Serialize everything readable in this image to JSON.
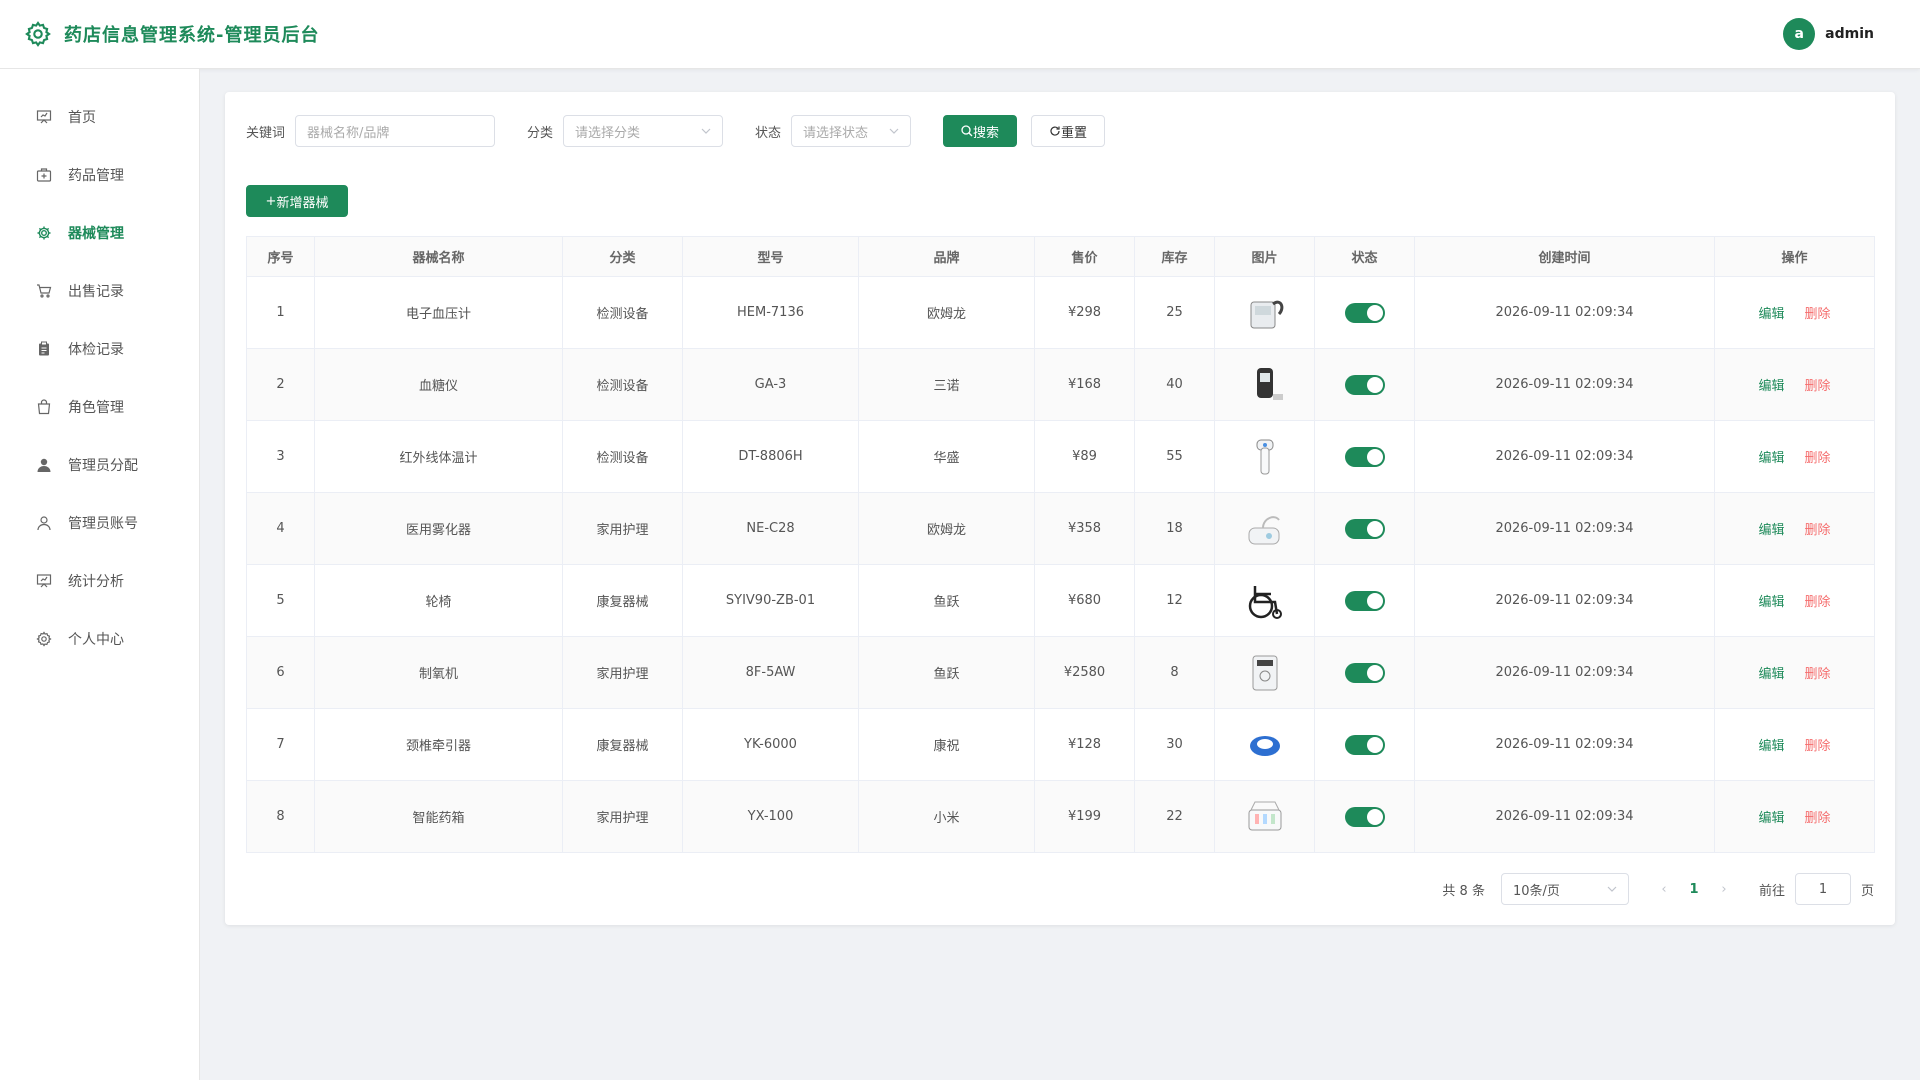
{
  "header": {
    "title": "药店信息管理系统-管理员后台",
    "avatar_letter": "a",
    "username": "admin"
  },
  "sidebar": {
    "items": [
      {
        "label": "首页",
        "icon": "presentation-icon"
      },
      {
        "label": "药品管理",
        "icon": "medicine-box-icon"
      },
      {
        "label": "器械管理",
        "icon": "gear-icon",
        "active": true
      },
      {
        "label": "出售记录",
        "icon": "cart-icon"
      },
      {
        "label": "体检记录",
        "icon": "clipboard-icon"
      },
      {
        "label": "角色管理",
        "icon": "bag-icon"
      },
      {
        "label": "管理员分配",
        "icon": "user-filled-icon"
      },
      {
        "label": "管理员账号",
        "icon": "user-icon"
      },
      {
        "label": "统计分析",
        "icon": "chart-board-icon"
      },
      {
        "label": "个人中心",
        "icon": "settings-icon"
      }
    ]
  },
  "filters": {
    "keyword_label": "关键词",
    "keyword_placeholder": "器械名称/品牌",
    "category_label": "分类",
    "category_placeholder": "请选择分类",
    "status_label": "状态",
    "status_placeholder": "请选择状态",
    "search_label": "搜索",
    "reset_label": "重置"
  },
  "add_label": "新增器械",
  "table": {
    "headers": [
      "序号",
      "器械名称",
      "分类",
      "型号",
      "品牌",
      "售价",
      "库存",
      "图片",
      "状态",
      "创建时间",
      "操作"
    ],
    "rows": [
      {
        "idx": "1",
        "name": "电子血压计",
        "cat": "检测设备",
        "model": "HEM-7136",
        "brand": "欧姆龙",
        "price": "¥298",
        "stock": "25",
        "time": "2026-09-11 02:09:34"
      },
      {
        "idx": "2",
        "name": "血糖仪",
        "cat": "检测设备",
        "model": "GA-3",
        "brand": "三诺",
        "price": "¥168",
        "stock": "40",
        "time": "2026-09-11 02:09:34"
      },
      {
        "idx": "3",
        "name": "红外线体温计",
        "cat": "检测设备",
        "model": "DT-8806H",
        "brand": "华盛",
        "price": "¥89",
        "stock": "55",
        "time": "2026-09-11 02:09:34"
      },
      {
        "idx": "4",
        "name": "医用雾化器",
        "cat": "家用护理",
        "model": "NE-C28",
        "brand": "欧姆龙",
        "price": "¥358",
        "stock": "18",
        "time": "2026-09-11 02:09:34"
      },
      {
        "idx": "5",
        "name": "轮椅",
        "cat": "康复器械",
        "model": "SYIV90-ZB-01",
        "brand": "鱼跃",
        "price": "¥680",
        "stock": "12",
        "time": "2026-09-11 02:09:34"
      },
      {
        "idx": "6",
        "name": "制氧机",
        "cat": "家用护理",
        "model": "8F-5AW",
        "brand": "鱼跃",
        "price": "¥2580",
        "stock": "8",
        "time": "2026-09-11 02:09:34"
      },
      {
        "idx": "7",
        "name": "颈椎牵引器",
        "cat": "康复器械",
        "model": "YK-6000",
        "brand": "康祝",
        "price": "¥128",
        "stock": "30",
        "time": "2026-09-11 02:09:34"
      },
      {
        "idx": "8",
        "name": "智能药箱",
        "cat": "家用护理",
        "model": "YX-100",
        "brand": "小米",
        "price": "¥199",
        "stock": "22",
        "time": "2026-09-11 02:09:34"
      }
    ],
    "edit_label": "编辑",
    "delete_label": "删除"
  },
  "pagination": {
    "total_text": "共 8 条",
    "page_size": "10条/页",
    "current_page": "1",
    "goto_label": "前往",
    "goto_value": "1",
    "page_suffix": "页"
  },
  "colors": {
    "primary": "#1e8a5a",
    "danger": "#f56c6c"
  }
}
